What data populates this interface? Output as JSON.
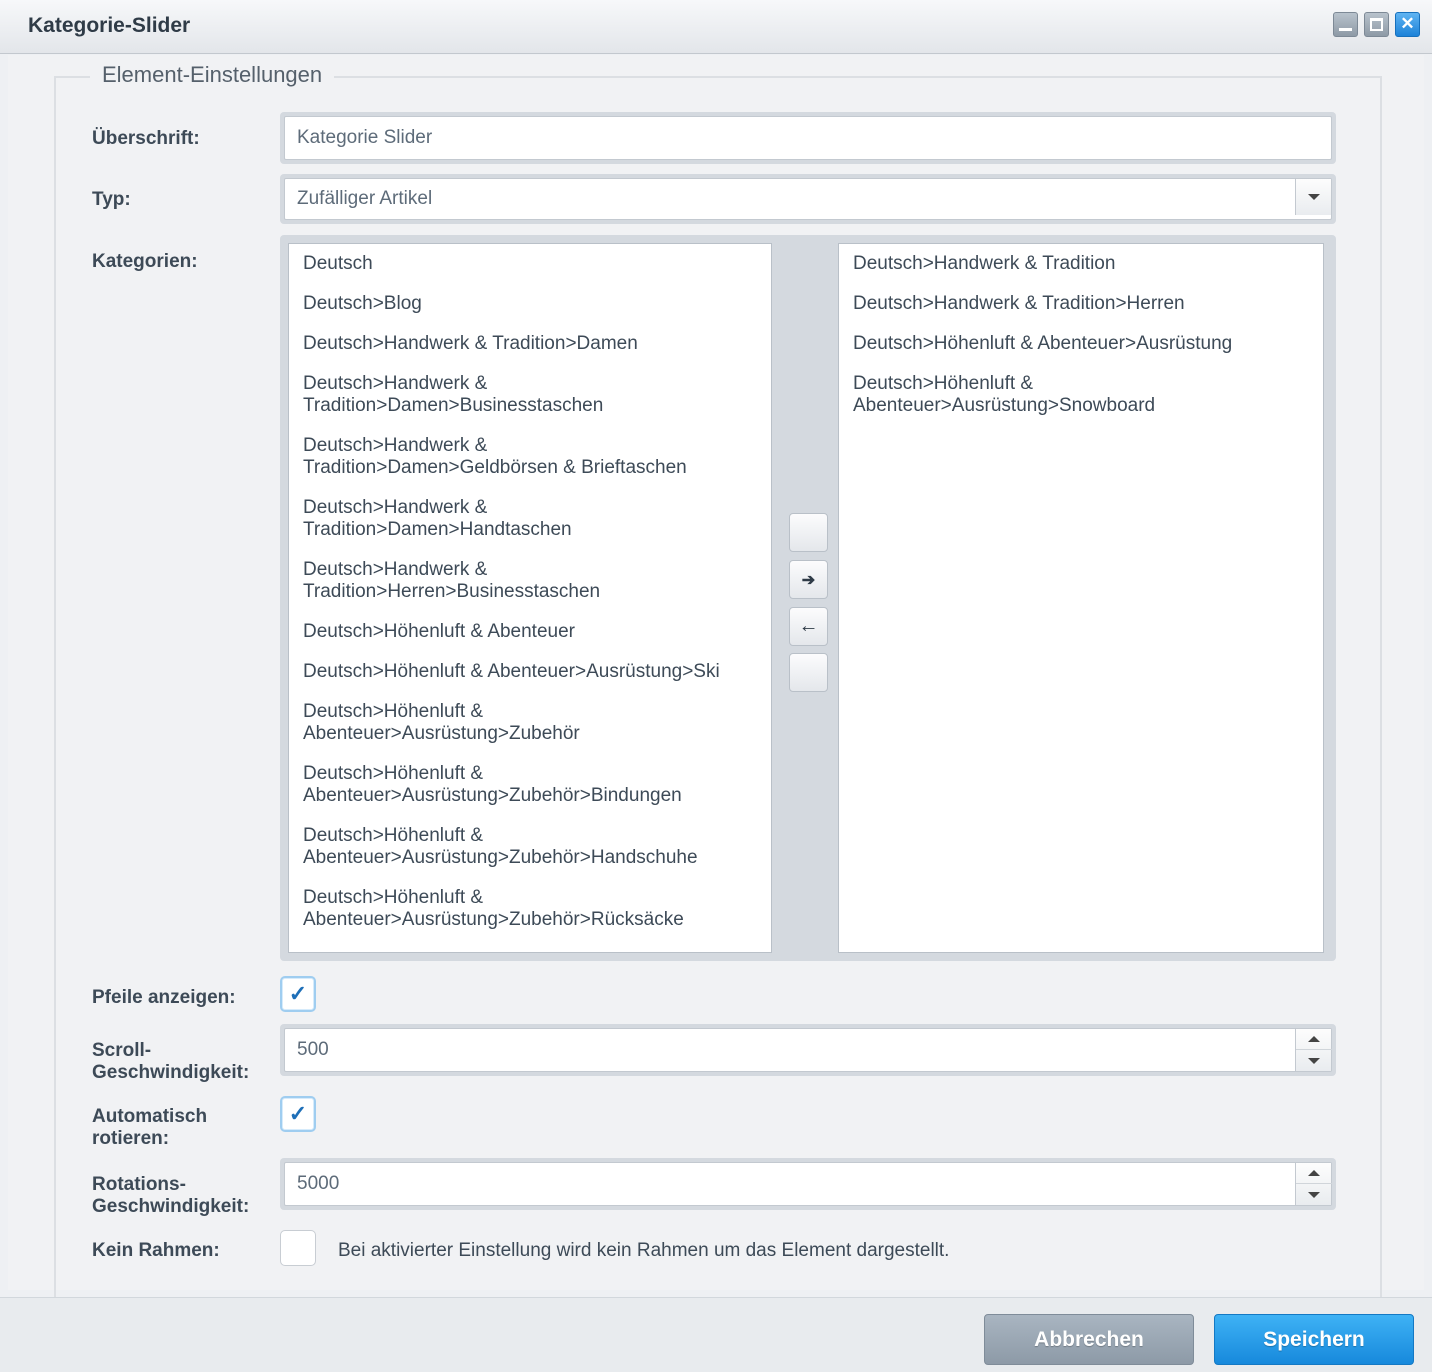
{
  "window": {
    "title": "Kategorie-Slider",
    "controls": [
      "minimize",
      "maximize",
      "close"
    ],
    "close_glyph": "✕"
  },
  "fieldset": {
    "legend": "Element-Einstellungen"
  },
  "form": {
    "heading": {
      "label": "Überschrift:",
      "value": "Kategorie Slider"
    },
    "type": {
      "label": "Typ:",
      "selected": "Zufälliger Artikel"
    },
    "categories": {
      "label": "Kategorien:",
      "available": [
        [
          "Deutsch"
        ],
        [
          "Deutsch>Blog"
        ],
        [
          "Deutsch>Handwerk & Tradition>Damen"
        ],
        [
          "Deutsch>Handwerk &",
          "Tradition>Damen>Businesstaschen"
        ],
        [
          "Deutsch>Handwerk &",
          "Tradition>Damen>Geldbörsen & Brieftaschen"
        ],
        [
          "Deutsch>Handwerk &",
          "Tradition>Damen>Handtaschen"
        ],
        [
          "Deutsch>Handwerk &",
          "Tradition>Herren>Businesstaschen"
        ],
        [
          "Deutsch>Höhenluft & Abenteuer"
        ],
        [
          "Deutsch>Höhenluft & Abenteuer>Ausrüstung>Ski"
        ],
        [
          "Deutsch>Höhenluft &",
          "Abenteuer>Ausrüstung>Zubehör"
        ],
        [
          "Deutsch>Höhenluft &",
          "Abenteuer>Ausrüstung>Zubehör>Bindungen"
        ],
        [
          "Deutsch>Höhenluft &",
          "Abenteuer>Ausrüstung>Zubehör>Handschuhe"
        ],
        [
          "Deutsch>Höhenluft &",
          "Abenteuer>Ausrüstung>Zubehör>Rücksäcke"
        ]
      ],
      "selected": [
        [
          "Deutsch>Handwerk & Tradition"
        ],
        [
          "Deutsch>Handwerk & Tradition>Herren"
        ],
        [
          "Deutsch>Höhenluft & Abenteuer>Ausrüstung"
        ],
        [
          "Deutsch>Höhenluft &",
          "Abenteuer>Ausrüstung>Snowboard"
        ]
      ],
      "buttons": {
        "move_right": "➔",
        "move_left": "←"
      }
    },
    "show_arrows": {
      "label": "Pfeile anzeigen:",
      "checked": true
    },
    "scroll_speed": {
      "label_line1": "Scroll-",
      "label_line2": "Geschwindigkeit:",
      "value": "500"
    },
    "auto_rotate": {
      "label_line1": "Automatisch",
      "label_line2": "rotieren:",
      "checked": true
    },
    "rotation_speed": {
      "label_line1": "Rotations-",
      "label_line2": "Geschwindigkeit:",
      "value": "5000"
    },
    "no_border": {
      "label": "Kein Rahmen:",
      "checked": false,
      "note": "Bei aktivierter Einstellung wird kein Rahmen um das Element dargestellt."
    },
    "check_glyph": "✓"
  },
  "footer": {
    "cancel_label": "Abbrechen",
    "save_label": "Speichern"
  },
  "colors": {
    "primary": "#1f8fe0",
    "secondary": "#97a4b1"
  }
}
